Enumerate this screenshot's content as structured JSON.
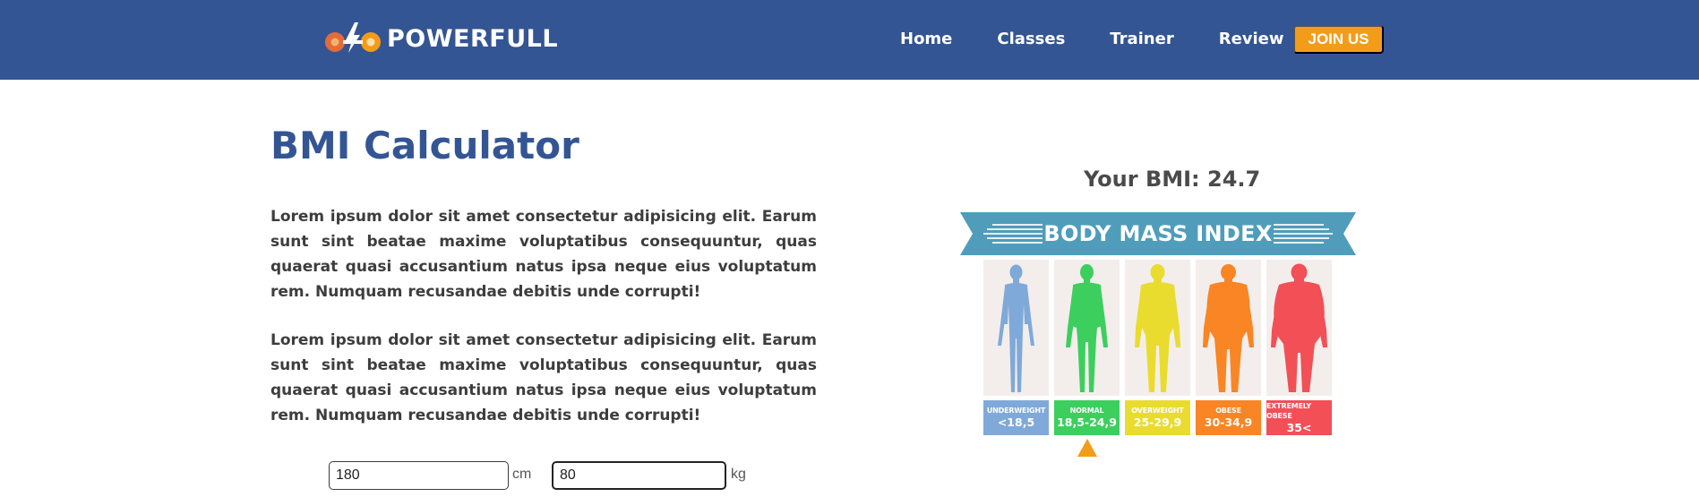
{
  "brand": {
    "name": "POWERFULL"
  },
  "nav": {
    "links": [
      "Home",
      "Classes",
      "Trainer",
      "Review"
    ],
    "cta": "JOIN US"
  },
  "colors": {
    "nav_bg": "#345593",
    "accent": "#f39c1a",
    "title": "#345593"
  },
  "main": {
    "title": "BMI Calculator",
    "paragraphs": [
      "Lorem ipsum dolor sit amet consectetur adipisicing elit. Earum sunt sint beatae maxime voluptatibus consequuntur, quas quaerat quasi accusantium natus ipsa neque eius voluptatum rem. Numquam recusandae debitis unde corrupti!",
      "Lorem ipsum dolor sit amet consectetur adipisicing elit. Earum sunt sint beatae maxime voluptatibus consequuntur, quas quaerat quasi accusantium natus ipsa neque eius voluptatum rem. Numquam recusandae debitis unde corrupti!"
    ],
    "height": {
      "value": "180",
      "unit": "cm"
    },
    "weight": {
      "value": "80",
      "unit": "kg"
    }
  },
  "result": {
    "label": "Your BMI: 24.7",
    "value": 24.7
  },
  "bmi_chart": {
    "banner": "BODY MASS INDEX",
    "selected": "NORMAL",
    "categories": [
      {
        "name": "UNDERWEIGHT",
        "range": "<18,5",
        "color": "#7fa9d8"
      },
      {
        "name": "NORMAL",
        "range": "18,5-24,9",
        "color": "#3ccf5e"
      },
      {
        "name": "OVERWEIGHT",
        "range": "25-29,9",
        "color": "#e9dc2e"
      },
      {
        "name": "OBESE",
        "range": "30-34,9",
        "color": "#f98524"
      },
      {
        "name": "EXTREMELY OBESE",
        "range": "35<",
        "color": "#f24f57"
      }
    ]
  }
}
